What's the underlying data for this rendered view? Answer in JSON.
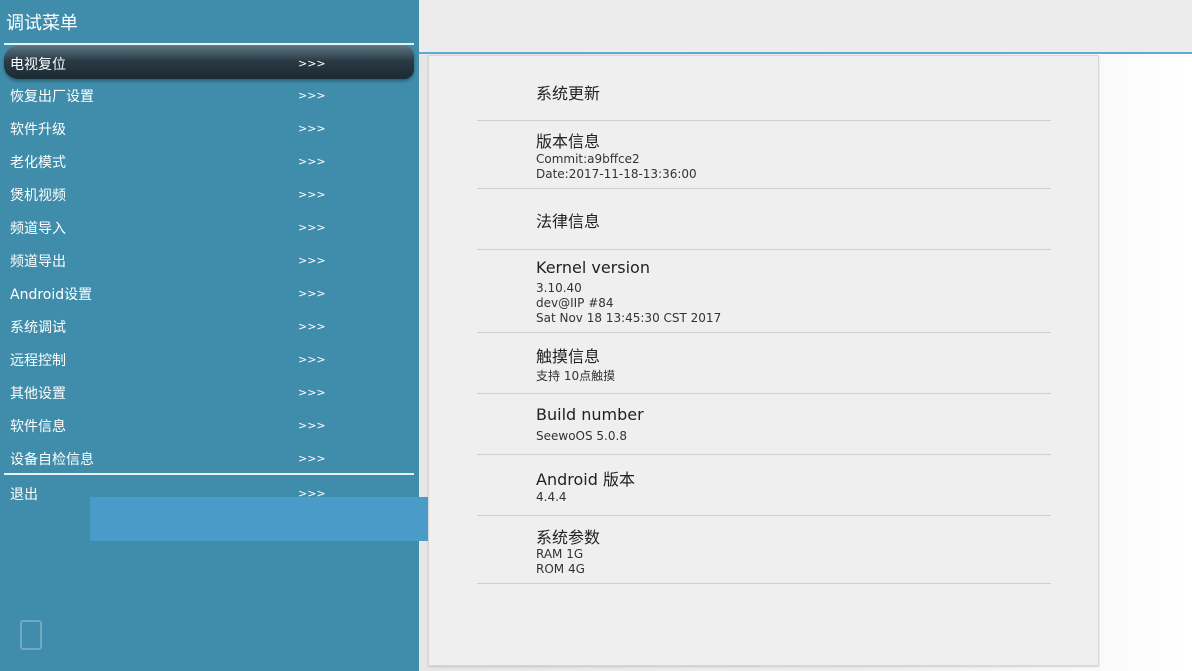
{
  "menu": {
    "title": "调试菜单",
    "arrow": ">>>",
    "items": [
      {
        "label": "电视复位",
        "selected": true
      },
      {
        "label": "恢复出厂设置"
      },
      {
        "label": "软件升级"
      },
      {
        "label": "老化模式"
      },
      {
        "label": "煲机视频"
      },
      {
        "label": "频道导入"
      },
      {
        "label": "频道导出"
      },
      {
        "label": "Android设置"
      },
      {
        "label": "系统调试"
      },
      {
        "label": "远程控制"
      },
      {
        "label": "其他设置"
      },
      {
        "label": "软件信息"
      },
      {
        "label": "设备自检信息"
      }
    ],
    "exit_label": "退出"
  },
  "info": {
    "rows": [
      {
        "title": "系统更新",
        "lines": []
      },
      {
        "title": "版本信息",
        "lines": [
          "Commit:a9bffce2",
          "Date:2017-11-18-13:36:00"
        ]
      },
      {
        "title": "法律信息",
        "lines": []
      },
      {
        "title": "Kernel version",
        "lines": [
          "3.10.40",
          "dev@IIP #84",
          "Sat Nov 18 13:45:30 CST 2017"
        ]
      },
      {
        "title": "触摸信息",
        "lines": [
          "支持 10点触摸"
        ]
      },
      {
        "title": "Build number",
        "lines": [
          "SeewoOS 5.0.8"
        ]
      },
      {
        "title": "Android 版本",
        "lines": [
          "4.4.4"
        ]
      },
      {
        "title": "系统参数",
        "lines": [
          "RAM  1G",
          "ROM  4G"
        ]
      }
    ]
  },
  "colors": {
    "menu_bg": "#3f8dab",
    "accent_line": "#5aa9d6",
    "card_bg": "#efefef"
  },
  "icons": {
    "bottom_left": "document-icon"
  }
}
